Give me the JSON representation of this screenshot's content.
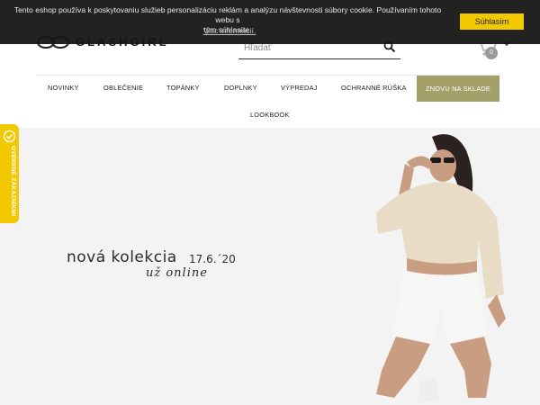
{
  "cookie_bar": {
    "message_line1": "Tento eshop používa k poskytovaniu služieb personalizáciu reklám a analýzu návštevnosti súbory cookie. Používaním tohoto webu s",
    "message_line2": "tým súhlasíte.",
    "info_link": "Viac informácií.",
    "accept_label": "Súhlasím"
  },
  "header": {
    "logo_text": "GLASHGIRL",
    "search": {
      "placeholder": "Hľadať"
    },
    "cart": {
      "count": "0"
    }
  },
  "nav": {
    "items": [
      {
        "label": "NOVINKY"
      },
      {
        "label": "OBLEČENIE"
      },
      {
        "label": "TOPÁNKY"
      },
      {
        "label": "DOPLNKY"
      },
      {
        "label": "VÝPREDAJ"
      },
      {
        "label": "OCHRANNÉ RÚŠKA"
      },
      {
        "label": "ZNOVU NA SKLADE"
      },
      {
        "label": "LOOKBOOK"
      }
    ]
  },
  "hero": {
    "headline": "nová kolekcia",
    "date": "17.6.´20",
    "subline": "už online"
  },
  "badge": {
    "label": "OVERENÉ ZÁKAZNÍKMI"
  },
  "colors": {
    "accent_yellow": "#f2c900",
    "nav_highlight": "#a4a06a",
    "cookie_bg": "#141414"
  }
}
